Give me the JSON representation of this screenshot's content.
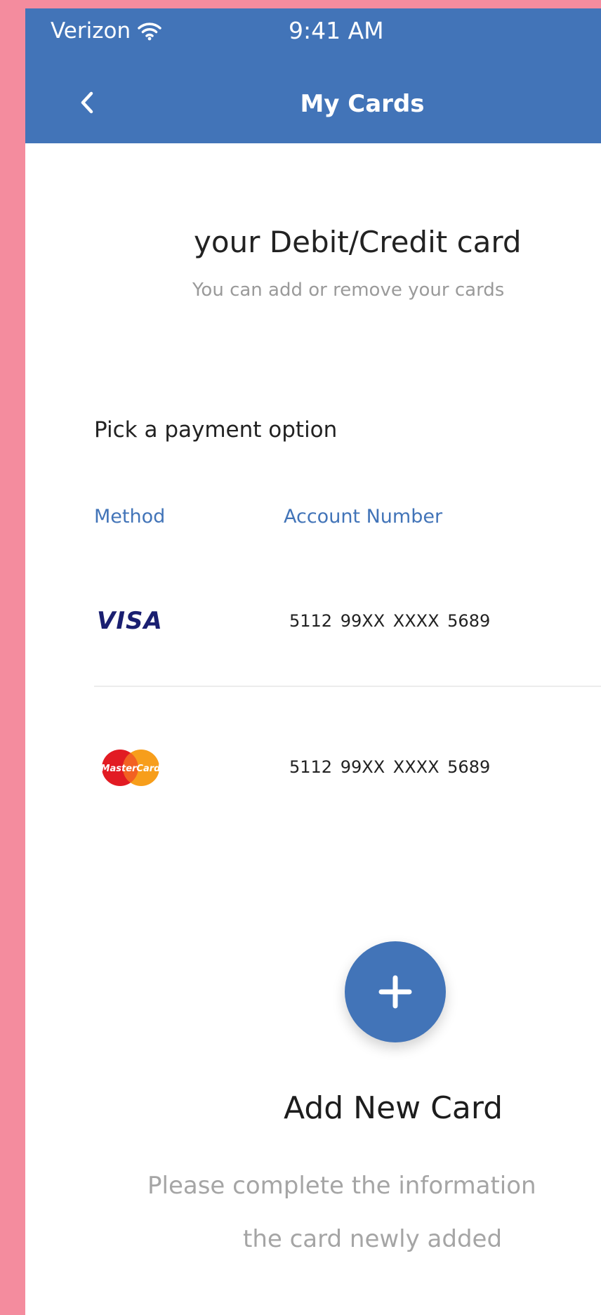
{
  "status_bar": {
    "carrier": "Verizon",
    "time": "9:41 AM",
    "wifi_icon": "wifi-icon"
  },
  "header": {
    "title": "My Cards",
    "back_icon": "chevron-left-icon",
    "background_color": "#4274b8"
  },
  "intro": {
    "heading": "your Debit/Credit card",
    "subheading": "You can add or remove your cards"
  },
  "payment": {
    "section_label": "Pick a payment option",
    "columns": {
      "method": "Method",
      "account_number": "Account Number"
    },
    "cards": [
      {
        "method": "VISA",
        "logo_icon": "visa-logo-icon",
        "account_number": "5112 99XX XXXX 5689"
      },
      {
        "method": "MasterCard",
        "logo_icon": "mastercard-logo-icon",
        "account_number": "5112 99XX XXXX 5689"
      }
    ]
  },
  "add_card": {
    "button_icon": "plus-icon",
    "title": "Add New Card",
    "description_line1": "Please complete the information",
    "description_line2": "the card newly added"
  },
  "colors": {
    "accent": "#4274b8",
    "page_background": "#f48c9e"
  }
}
